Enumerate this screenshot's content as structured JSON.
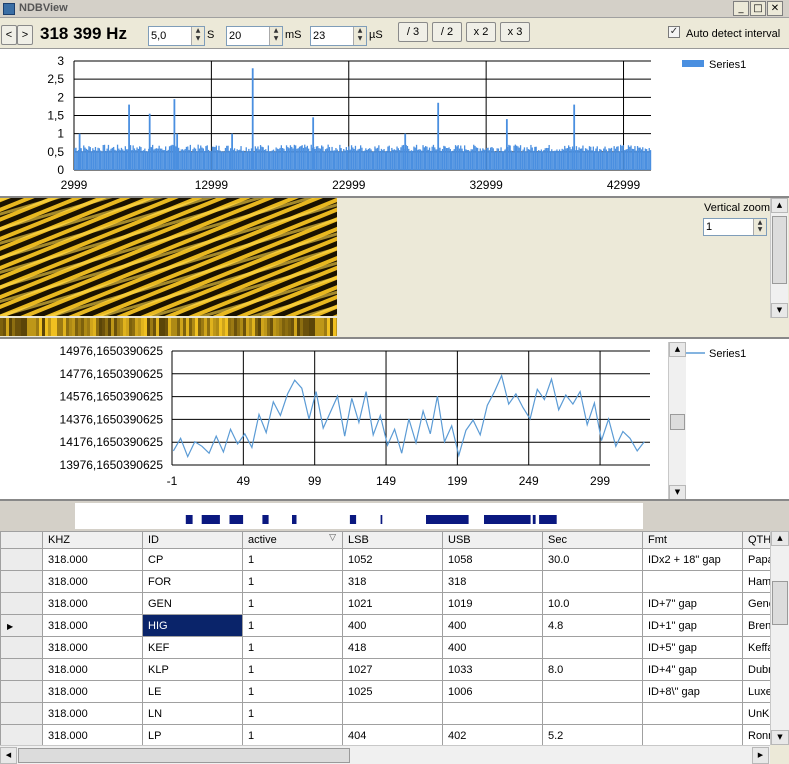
{
  "window": {
    "title": "NDBView"
  },
  "window_buttons": {
    "minimize": "_",
    "maximize": "□",
    "close": "✕"
  },
  "toolbar": {
    "prev": "<",
    "next": ">",
    "frequency": "318 399 Hz",
    "seconds_value": "5,0",
    "seconds_unit": "S",
    "ms_value": "20",
    "ms_unit": "mS",
    "us_value": "23",
    "us_unit": "µS",
    "div3": "/ 3",
    "div2": "/ 2",
    "x2": "x 2",
    "x3": "x 3",
    "auto_detect_label": "Auto detect interval",
    "auto_detect_checked": true
  },
  "spectrogram": {
    "vertical_zoom_label": "Vertical zoom",
    "vertical_zoom_value": "1"
  },
  "chart_data": [
    {
      "type": "bar",
      "legend": [
        "Series1"
      ],
      "legend_position": "top-right",
      "x_ticks": [
        "2999",
        "12999",
        "22999",
        "32999",
        "42999"
      ],
      "y_ticks": [
        "0",
        "0,5",
        "1",
        "1,5",
        "2",
        "2,5",
        "3"
      ],
      "xlim": [
        2999,
        44999
      ],
      "ylim": [
        0,
        3
      ],
      "baseline": 0.45,
      "peaks": [
        {
          "x": 3400,
          "y": 1.0
        },
        {
          "x": 7000,
          "y": 1.8
        },
        {
          "x": 8500,
          "y": 1.55
        },
        {
          "x": 10300,
          "y": 1.95
        },
        {
          "x": 10500,
          "y": 1.0
        },
        {
          "x": 14500,
          "y": 1.0
        },
        {
          "x": 16000,
          "y": 2.8
        },
        {
          "x": 20400,
          "y": 1.45
        },
        {
          "x": 27100,
          "y": 1.0
        },
        {
          "x": 29500,
          "y": 1.85
        },
        {
          "x": 34500,
          "y": 1.4
        },
        {
          "x": 39400,
          "y": 1.8
        }
      ],
      "color": "#4a8fe0",
      "grid": true
    },
    {
      "type": "line",
      "legend": [
        "Series1"
      ],
      "legend_position": "top-right",
      "x_ticks": [
        "-1",
        "49",
        "99",
        "149",
        "199",
        "249",
        "299"
      ],
      "y_ticks": [
        "13976,1650390625",
        "14176,1650390625",
        "14376,1650390625",
        "14576,1650390625",
        "14776,1650390625",
        "14976,1650390625"
      ],
      "xlim": [
        -1,
        334
      ],
      "ylim": [
        13976.1650390625,
        14976.1650390625
      ],
      "x": [
        0,
        5,
        10,
        15,
        20,
        25,
        30,
        35,
        40,
        45,
        50,
        55,
        60,
        65,
        70,
        75,
        80,
        85,
        90,
        95,
        100,
        105,
        110,
        115,
        120,
        125,
        130,
        135,
        140,
        145,
        150,
        155,
        160,
        165,
        170,
        175,
        180,
        185,
        190,
        195,
        200,
        205,
        210,
        215,
        220,
        225,
        230,
        235,
        240,
        245,
        250,
        255,
        260,
        265,
        270,
        275,
        280,
        285,
        290,
        295,
        300,
        305,
        310,
        315,
        320,
        325,
        330
      ],
      "y": [
        14100,
        14210,
        14050,
        14180,
        14140,
        14080,
        14230,
        14090,
        14290,
        14160,
        14250,
        14130,
        14420,
        14260,
        14530,
        14410,
        14600,
        14720,
        14650,
        14380,
        14620,
        14300,
        14440,
        14580,
        14230,
        14560,
        14350,
        14620,
        14240,
        14410,
        14150,
        14290,
        14080,
        14380,
        14170,
        14450,
        14250,
        14580,
        14180,
        14320,
        14060,
        14280,
        14370,
        14240,
        14500,
        14620,
        14760,
        14510,
        14600,
        14480,
        14380,
        14640,
        14550,
        14730,
        14460,
        14590,
        14510,
        14620,
        14330,
        14520,
        14190,
        14380,
        14140,
        14270,
        14210,
        14100,
        14180
      ],
      "color": "#5b9bd5",
      "grid": true
    }
  ],
  "id_strip": {
    "blocks": [
      {
        "start": 0.195,
        "end": 0.207
      },
      {
        "start": 0.223,
        "end": 0.255
      },
      {
        "start": 0.272,
        "end": 0.296
      },
      {
        "start": 0.33,
        "end": 0.341
      },
      {
        "start": 0.382,
        "end": 0.39
      },
      {
        "start": 0.484,
        "end": 0.495
      },
      {
        "start": 0.538,
        "end": 0.541
      },
      {
        "start": 0.618,
        "end": 0.693
      },
      {
        "start": 0.72,
        "end": 0.802
      },
      {
        "start": 0.806,
        "end": 0.811
      },
      {
        "start": 0.817,
        "end": 0.848
      }
    ],
    "color": "#0a1880"
  },
  "grid": {
    "columns": [
      "KHZ",
      "ID",
      "active",
      "LSB",
      "USB",
      "Sec",
      "Fmt",
      "QTH"
    ],
    "sort_indicator": "▽",
    "selected_row": 3,
    "selected_col": 1,
    "rows": [
      [
        "318.000",
        "CP",
        "1",
        "1052",
        "1058",
        "30.0",
        "IDx2 + 18\" gap",
        "Papa"
      ],
      [
        "318.000",
        "FOR",
        "1",
        "318",
        "318",
        "",
        "",
        "Hamr"
      ],
      [
        "318.000",
        "GEN",
        "1",
        "1021",
        "1019",
        "10.0",
        "ID+7\" gap",
        "Genc"
      ],
      [
        "318.000",
        "HIG",
        "1",
        "400",
        "400",
        "4.8",
        "ID+1\" gap",
        "Bren"
      ],
      [
        "318.000",
        "KEF",
        "1",
        "418",
        "400",
        "",
        "ID+5\" gap",
        "Keffa"
      ],
      [
        "318.000",
        "KLP",
        "1",
        "1027",
        "1033",
        "8.0",
        "ID+4\" gap",
        "Dubr"
      ],
      [
        "318.000",
        "LE",
        "1",
        "1025",
        "1006",
        "",
        "ID+8\\\" gap",
        "Luxe"
      ],
      [
        "318.000",
        "LN",
        "1",
        "",
        "",
        "",
        "",
        "UnKr"
      ],
      [
        "318.000",
        "LP",
        "1",
        "404",
        "402",
        "5.2",
        "",
        "Ronn"
      ]
    ]
  },
  "icons": {
    "row_pointer": "▶",
    "scroll_up": "▲",
    "scroll_down": "▼",
    "scroll_left": "◀",
    "scroll_right": "▶",
    "checkmark": "✓"
  }
}
